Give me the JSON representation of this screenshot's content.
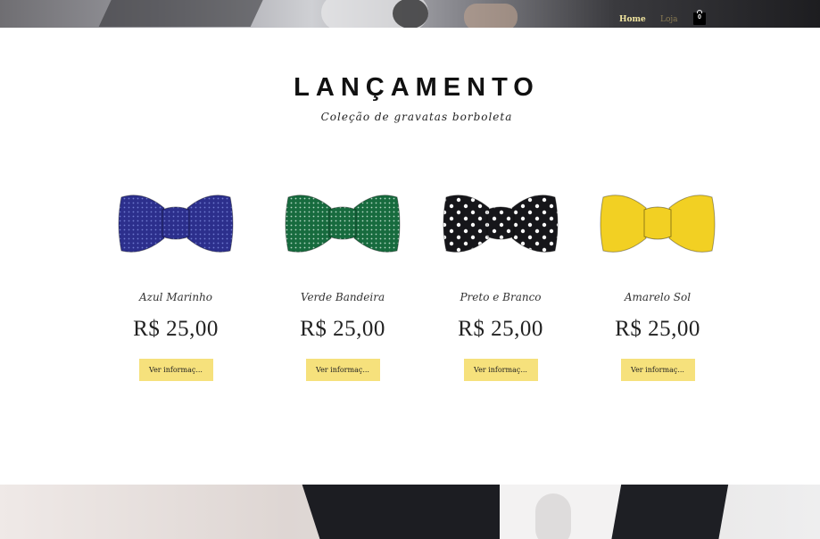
{
  "nav": {
    "home_label": "Home",
    "loja_label": "Loja",
    "cart_count": "0"
  },
  "section": {
    "title": "LANÇAMENTO",
    "subtitle": "Coleção de gravatas borboleta"
  },
  "products": [
    {
      "name": "Azul Marinho",
      "price": "R$ 25,00",
      "button_label": "Ver informaç...",
      "color": "#2c2f8c",
      "dot_color": "#6f7ad0",
      "pattern": "dots"
    },
    {
      "name": "Verde Bandeira",
      "price": "R$ 25,00",
      "button_label": "Ver informaç...",
      "color": "#176b3e",
      "dot_color": "#b5d8c4",
      "pattern": "dots"
    },
    {
      "name": "Preto e Branco",
      "price": "R$ 25,00",
      "button_label": "Ver informaç...",
      "color": "#16161a",
      "dot_color": "#ffffff",
      "pattern": "polka"
    },
    {
      "name": "Amarelo Sol",
      "price": "R$ 25,00",
      "button_label": "Ver informaç...",
      "color": "#f2d023",
      "dot_color": "#f2d023",
      "pattern": "solid"
    }
  ],
  "colors": {
    "accent_button": "#f6e17c",
    "nav_active": "#f2e6a0",
    "nav_inactive": "#8a7b52"
  }
}
